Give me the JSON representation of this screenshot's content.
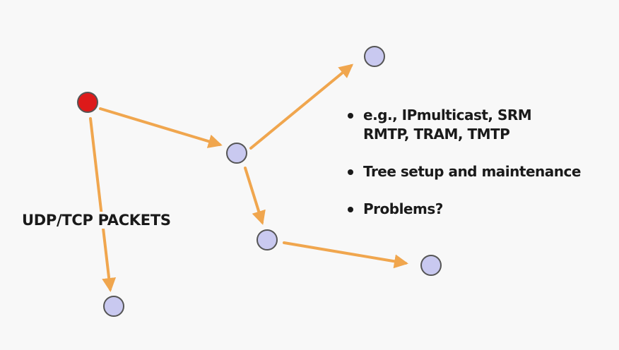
{
  "diagram": {
    "edge_color": "#f0a64e",
    "source_node_color": "#dd1a1a",
    "node_color": "#c9c9f0",
    "node_outline_color": "#555555",
    "packets_label": "UDP/TCP PACKETS"
  },
  "bullets": {
    "item1_line1": "e.g., IPmulticast, SRM",
    "item1_line2": "RMTP, TRAM, TMTP",
    "item2": "Tree setup and maintenance",
    "item3": "Problems?"
  }
}
